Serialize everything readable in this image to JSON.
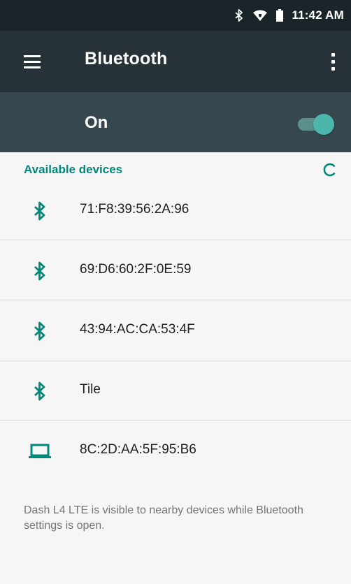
{
  "status_bar": {
    "time": "11:42 AM",
    "icons": [
      "bluetooth-icon",
      "wifi-icon",
      "battery-icon"
    ]
  },
  "app_bar": {
    "title": "Bluetooth",
    "menu_icon": "hamburger-menu-icon",
    "overflow_icon": "more-vert-icon"
  },
  "toggle": {
    "label": "On",
    "state": true
  },
  "section": {
    "title": "Available devices",
    "refresh_icon": "refresh-icon"
  },
  "devices": [
    {
      "name": "71:F8:39:56:2A:96",
      "icon": "bluetooth-icon"
    },
    {
      "name": "69:D6:60:2F:0E:59",
      "icon": "bluetooth-icon"
    },
    {
      "name": "43:94:AC:CA:53:4F",
      "icon": "bluetooth-icon"
    },
    {
      "name": "Tile",
      "icon": "bluetooth-icon"
    },
    {
      "name": "8C:2D:AA:5F:95:B6",
      "icon": "laptop-icon"
    }
  ],
  "footer": {
    "note": "Dash L4 LTE is visible to nearby devices while Bluetooth settings is open."
  },
  "colors": {
    "status_bar": "#1b2429",
    "app_bar": "#263238",
    "toggle_bar": "#37474f",
    "accent": "#00897b",
    "switch_thumb": "#4db6ac",
    "background": "#f6f6f6"
  }
}
